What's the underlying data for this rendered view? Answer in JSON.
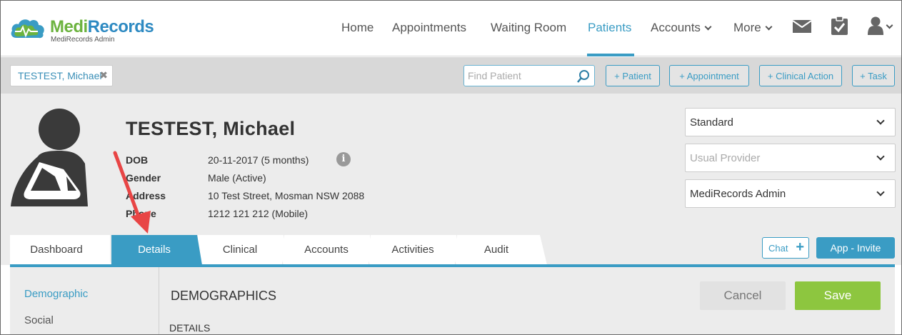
{
  "app": {
    "brand_part1": "Medi",
    "brand_part2": "Records",
    "brand_subtitle": "MediRecords Admin",
    "accent_color": "#3a9cc4",
    "brand_green": "#6cb33f",
    "save_color": "#8dc63f"
  },
  "nav": {
    "items": [
      {
        "label": "Home"
      },
      {
        "label": "Appointments"
      },
      {
        "label": "Waiting Room"
      },
      {
        "label": "Patients",
        "active": true
      },
      {
        "label": "Accounts",
        "dropdown": true
      },
      {
        "label": "More",
        "dropdown": true
      }
    ],
    "icons": [
      "mail-icon",
      "clipboard-check-icon",
      "user-icon"
    ]
  },
  "toolbar": {
    "patient_chip": "TESTEST, Michael",
    "find_placeholder": "Find Patient",
    "buttons": [
      "+ Patient",
      "+ Appointment",
      "+ Clinical Action",
      "+ Task"
    ]
  },
  "patient": {
    "name": "TESTEST, Michael",
    "fields": [
      {
        "label": "DOB",
        "value": "20-11-2017 (5 months)"
      },
      {
        "label": "Gender",
        "value": "Male (Active)"
      },
      {
        "label": "Address",
        "value": "10 Test Street, Mosman NSW 2088"
      },
      {
        "label": "Phone",
        "value": "1212 121 212 (Mobile)"
      }
    ],
    "selects": [
      {
        "value": "Standard",
        "placeholder": false
      },
      {
        "value": "Usual Provider",
        "placeholder": true
      },
      {
        "value": "MediRecords Admin",
        "placeholder": false
      }
    ]
  },
  "tabs": {
    "items": [
      "Dashboard",
      "Details",
      "Clinical",
      "Accounts",
      "Activities",
      "Audit"
    ],
    "active": "Details",
    "chat_label": "Chat",
    "invite_label": "App - Invite"
  },
  "sidebar": {
    "items": [
      {
        "label": "Demographic",
        "active": true
      },
      {
        "label": "Social"
      }
    ]
  },
  "main": {
    "section_title": "DEMOGRAPHICS",
    "subsection_title": "DETAILS",
    "cancel_label": "Cancel",
    "save_label": "Save"
  },
  "annotation": {
    "arrow_color": "#e84545"
  }
}
